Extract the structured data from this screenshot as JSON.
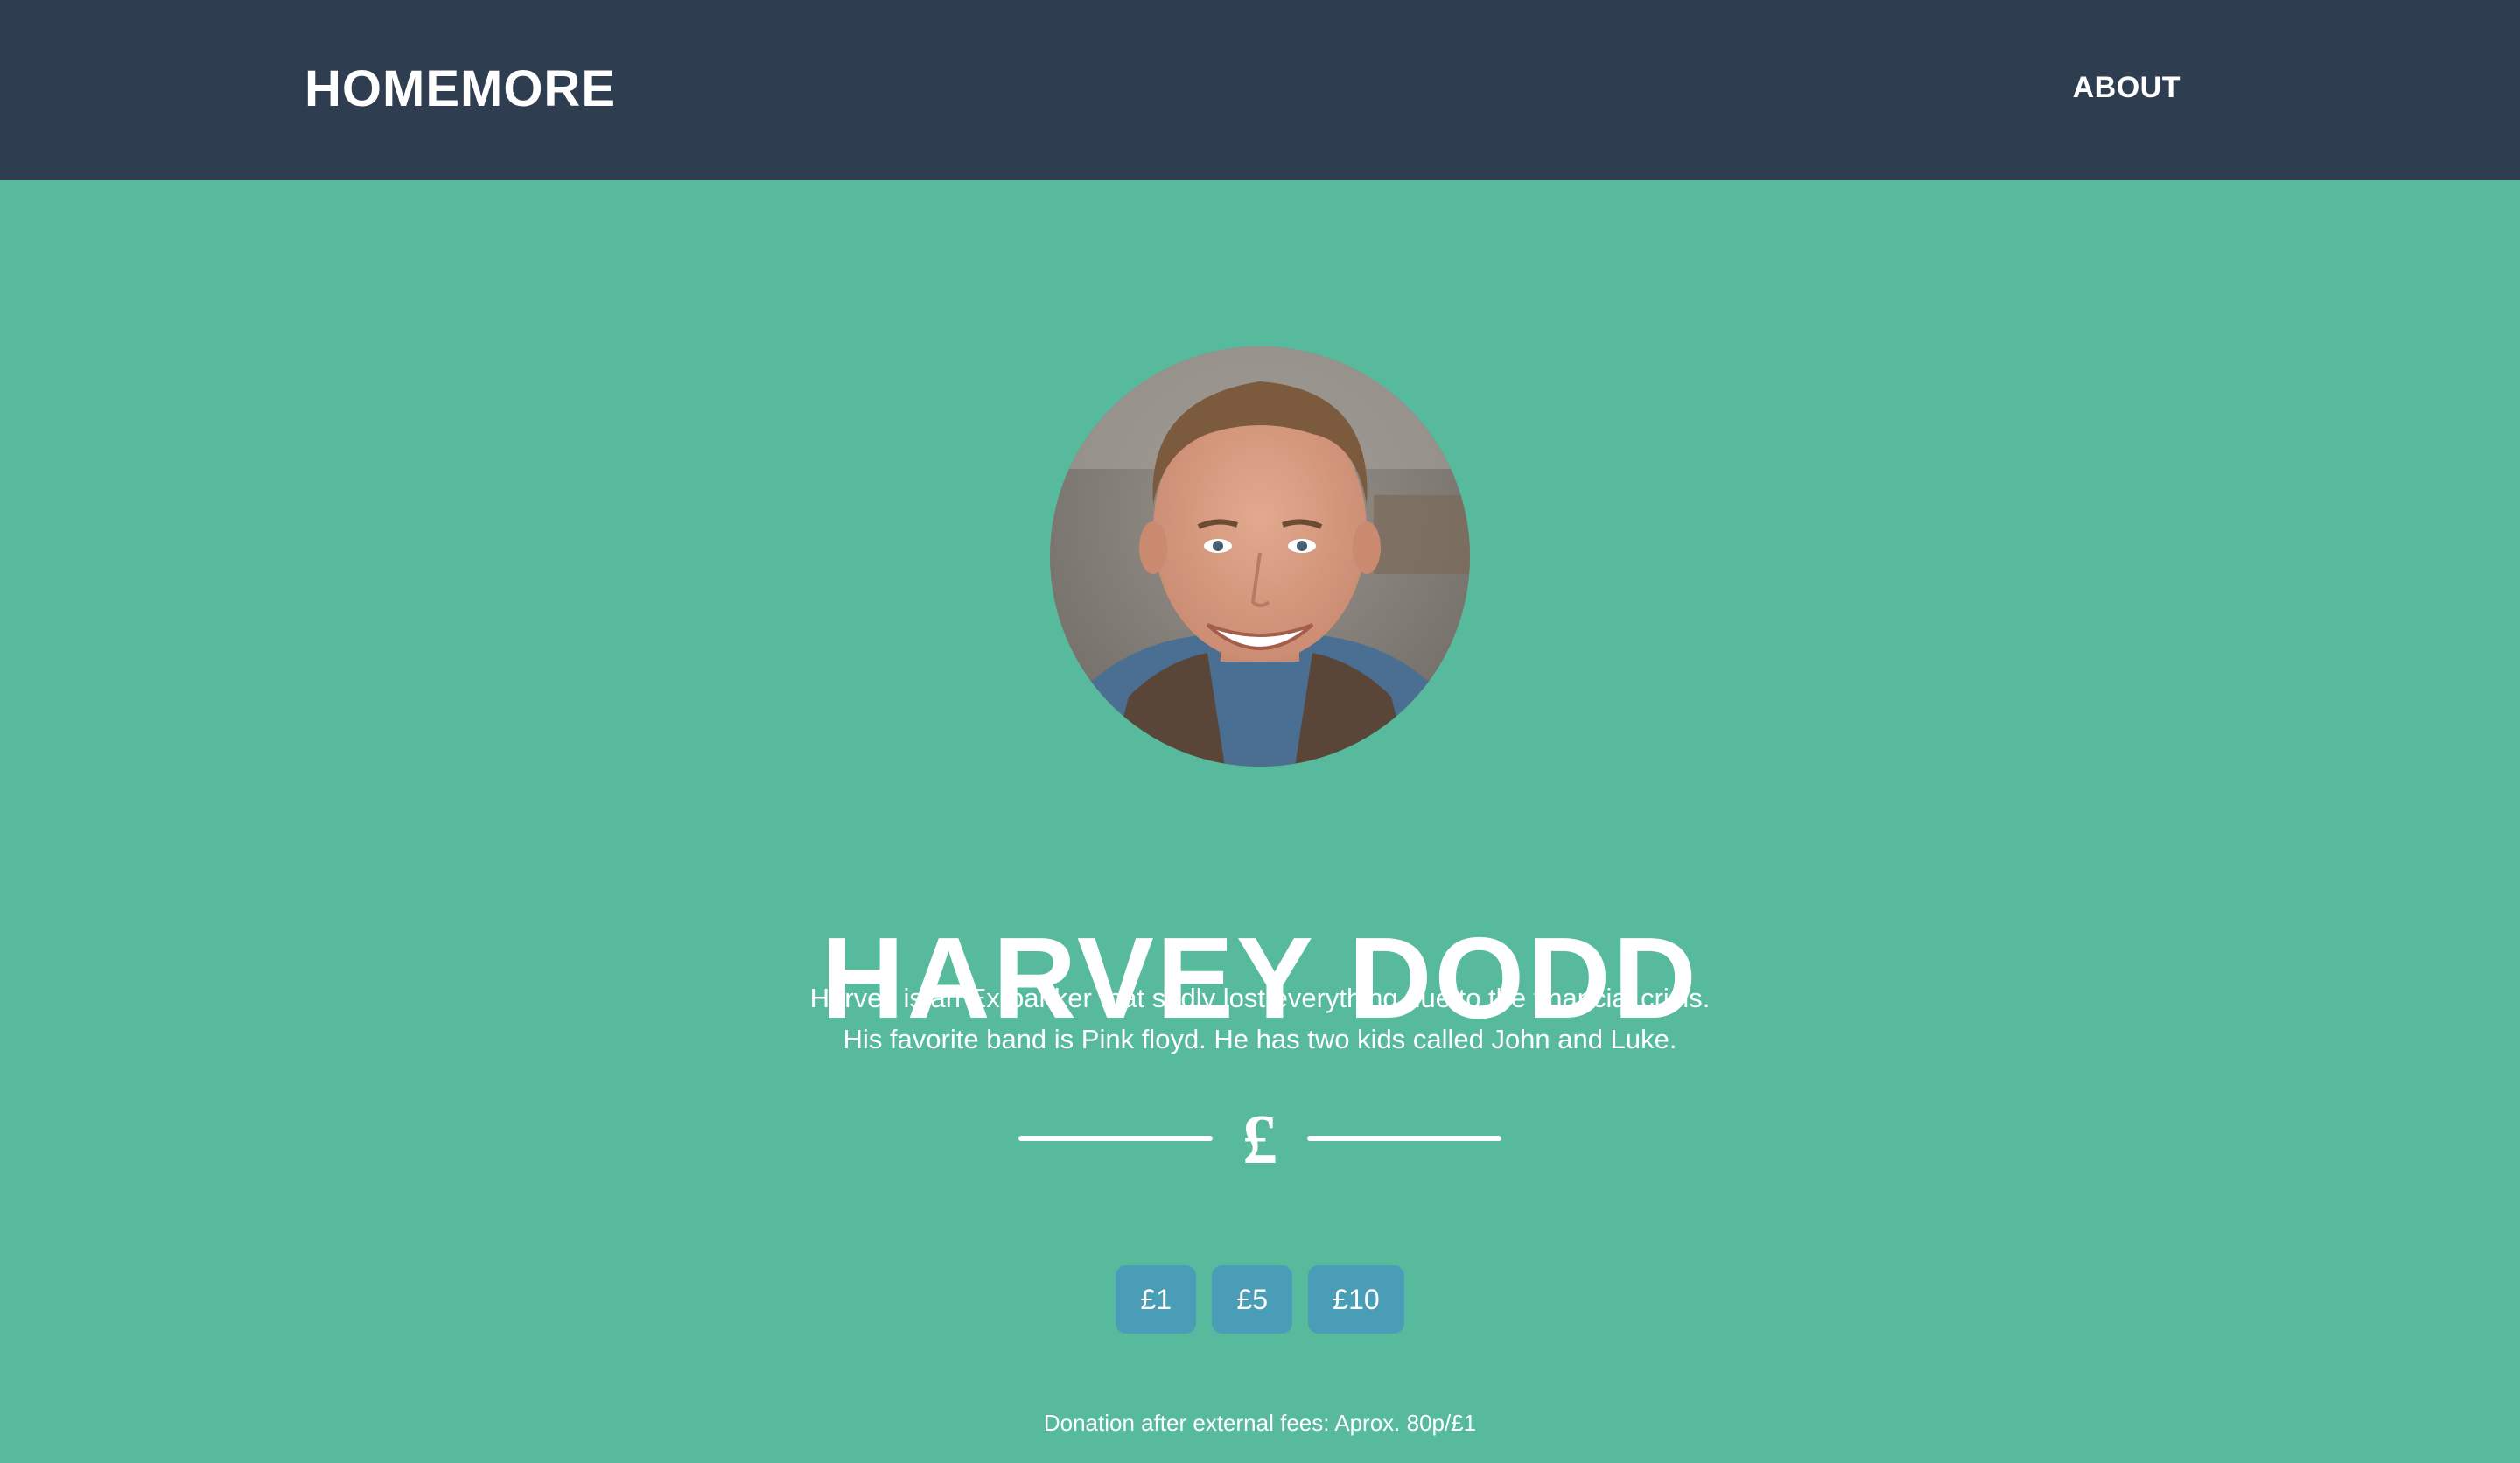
{
  "navbar": {
    "brand": "HOMEMORE",
    "about_label": "ABOUT"
  },
  "profile": {
    "name": "HARVEY DODD",
    "bio_line_1": "Harvey is an Ex-banker that sadly lost everything due to the financial crisis.",
    "bio_line_2": "His favorite band is Pink floyd. He has two kids called John and Luke.",
    "currency_symbol": "£"
  },
  "donation": {
    "amounts": [
      "£1",
      "£5",
      "£10"
    ],
    "fee_note": "Donation after external fees: Aprox. 80p/£1"
  },
  "colors": {
    "navbar_bg": "#2f3d50",
    "page_bg": "#57ba9c",
    "button_bg": "#4a9db6",
    "text": "#ffffff"
  }
}
